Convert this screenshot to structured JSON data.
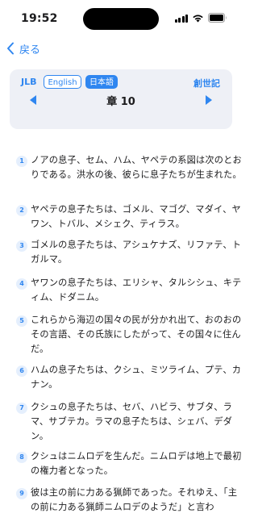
{
  "status_bar": {
    "time": "19:52"
  },
  "nav": {
    "back_label": "戻る"
  },
  "reader": {
    "version": "JLB",
    "languages": [
      "English",
      "日本語"
    ],
    "selected_language": "日本語",
    "book": "創世記",
    "chapter": "章 10",
    "prev_icon": "triangle-left-icon",
    "next_icon": "triangle-right-icon"
  },
  "accent_color": "#2f86f0",
  "verses": [
    {
      "num": "1",
      "text": "ノアの息子、セム、ハム、ヤペテの系図は次のとおりである。洪水の後、彼らに息子たちが生まれた。"
    },
    {
      "num": "2",
      "text": "ヤペテの息子たちは、ゴメル、マゴグ、マダイ、ヤワン、トバル、メシェク、ティラス。"
    },
    {
      "num": "3",
      "text": "ゴメルの息子たちは、アシュケナズ、リファテ、トガルマ。"
    },
    {
      "num": "4",
      "text": "ヤワンの息子たちは、エリシャ、タルシシュ、キティム、ドダニム。"
    },
    {
      "num": "5",
      "text": "これらから海辺の国々の民が分かれ出て、おのおのその言語、その氏族にしたがって、その国々に住んだ。"
    },
    {
      "num": "6",
      "text": "ハムの息子たちは、クシュ、ミツライム、プテ、カナン。"
    },
    {
      "num": "7",
      "text": "クシュの息子たちは、セバ、ハビラ、サブタ、ラマ、サブテカ。ラマの息子たちは、シェバ、デダン。"
    },
    {
      "num": "8",
      "text": "クシュはニムロデを生んだ。ニムロデは地上で最初の権力者となった。"
    },
    {
      "num": "9",
      "text": "彼は主の前に力ある猟師であった。それゆえ、「主の前に力ある猟師ニムロデのようだ」と言わ"
    }
  ]
}
